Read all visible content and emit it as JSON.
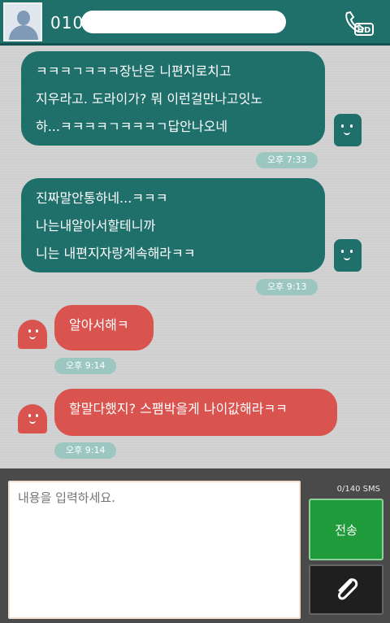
{
  "header": {
    "contact_prefix": "010"
  },
  "messages": [
    {
      "direction": "out",
      "text": "ㅋㅋㅋㄱㅋㅋㅋ장난은 니편지로치고\n지우라고. 도라이가? 뭐 이런걸만나고잇노\n하...ㅋㅋㅋㅋㄱㅋㅋㅋㄱ답안나오네",
      "time": "오후 7:33"
    },
    {
      "direction": "out",
      "text": "진짜말안통하네...ㅋㅋㅋ\n나는내알아서할테니까\n니는 내편지자랑계속해라ㅋㅋ",
      "time": "오후 9:13"
    },
    {
      "direction": "in",
      "text": "알아서해ㅋ",
      "time": "오후 9:14"
    },
    {
      "direction": "in",
      "text": "할말다했지? 스팸박을게 나이값해라ㅋㅋ",
      "time": "오후 9:14"
    }
  ],
  "compose": {
    "counter": "0/140 SMS",
    "placeholder": "내용을 입력하세요.",
    "value": "",
    "send_label": "전송"
  },
  "icons": {
    "call": "phone-hd-icon",
    "attach": "paperclip-icon"
  },
  "colors": {
    "header": "#1f6f6b",
    "outgoing": "#1f6f6b",
    "incoming": "#d9534f",
    "timestamp": "#9bc7c0",
    "send": "#1f9b3b"
  }
}
